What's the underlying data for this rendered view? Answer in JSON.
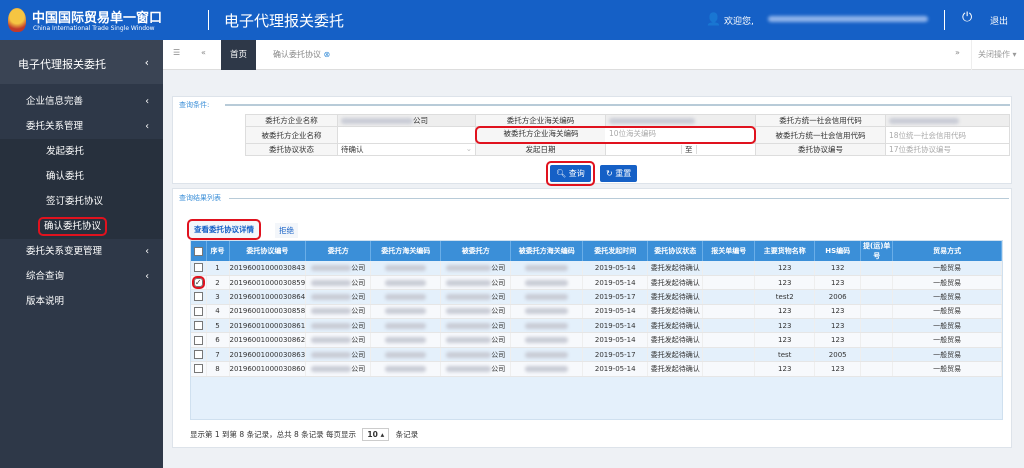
{
  "header": {
    "logo_cn": "中国国际贸易单一窗口",
    "logo_en": "China International Trade Single Window",
    "app_title": "电子代理报关委托",
    "welcome": "欢迎您,",
    "logout": "退出"
  },
  "tabs": {
    "home": "首页",
    "current": "确认委托协议",
    "close_ops": "关闭操作"
  },
  "sidebar": {
    "title": "电子代理报关委托",
    "items": [
      {
        "label": "企业信息完善",
        "chev": true,
        "sub": false
      },
      {
        "label": "委托关系管理",
        "chev": true,
        "sub": false
      },
      {
        "label": "发起委托",
        "sub": true
      },
      {
        "label": "确认委托",
        "sub": true
      },
      {
        "label": "签订委托协议",
        "sub": true
      },
      {
        "label": "确认委托协议",
        "sub": true,
        "active": true
      },
      {
        "label": "委托关系变更管理",
        "chev": true,
        "sub": false
      },
      {
        "label": "综合查询",
        "chev": true,
        "sub": false
      },
      {
        "label": "版本说明",
        "sub": false
      }
    ]
  },
  "query": {
    "legend": "查询条件:",
    "l1": "委托方企业名称",
    "v1_suffix": "公司",
    "l2": "委托方企业海关编码",
    "l3": "委托方统一社会信用代码",
    "l4": "被委托方企业名称",
    "l5": "被委托方企业海关编码",
    "p5": "10位海关编码",
    "l6": "被委托方统一社会信用代码",
    "p6": "18位统一社会信用代码",
    "l7": "委托协议状态",
    "v7": "待确认",
    "l8": "发起日期",
    "to": "至",
    "l9": "委托协议编号",
    "p9": "17位委托协议编号",
    "search": "查询",
    "reset": "重置"
  },
  "results": {
    "legend": "查询结果列表",
    "view_detail": "查看委托协议详情",
    "reject": "拒绝",
    "columns": [
      "序号",
      "委托协议编号",
      "委托方",
      "委托方海关编码",
      "被委托方",
      "被委托方海关编码",
      "委托发起时间",
      "委托协议状态",
      "报关单编号",
      "主要货物名称",
      "HS编码",
      "提(运)单号",
      "贸易方式"
    ],
    "rows": [
      {
        "no": "1",
        "id": "20196001000030843",
        "date": "2019-05-14",
        "status": "委托发起待确认",
        "goods": "123",
        "hs": "132",
        "trade": "一般贸易",
        "checked": false
      },
      {
        "no": "2",
        "id": "20196001000030859",
        "date": "2019-05-14",
        "status": "委托发起待确认",
        "goods": "123",
        "hs": "123",
        "trade": "一般贸易",
        "checked": true
      },
      {
        "no": "3",
        "id": "20196001000030864",
        "date": "2019-05-17",
        "status": "委托发起待确认",
        "goods": "test2",
        "hs": "2006",
        "trade": "一般贸易",
        "checked": false
      },
      {
        "no": "4",
        "id": "20196001000030858",
        "date": "2019-05-14",
        "status": "委托发起待确认",
        "goods": "123",
        "hs": "123",
        "trade": "一般贸易",
        "checked": false
      },
      {
        "no": "5",
        "id": "20196001000030861",
        "date": "2019-05-14",
        "status": "委托发起待确认",
        "goods": "123",
        "hs": "123",
        "trade": "一般贸易",
        "checked": false
      },
      {
        "no": "6",
        "id": "20196001000030862",
        "date": "2019-05-14",
        "status": "委托发起待确认",
        "goods": "123",
        "hs": "123",
        "trade": "一般贸易",
        "checked": false
      },
      {
        "no": "7",
        "id": "20196001000030863",
        "date": "2019-05-17",
        "status": "委托发起待确认",
        "goods": "test",
        "hs": "2005",
        "trade": "一般贸易",
        "checked": false
      },
      {
        "no": "8",
        "id": "20196001000030860",
        "date": "2019-05-14",
        "status": "委托发起待确认",
        "goods": "123",
        "hs": "123",
        "trade": "一般贸易",
        "checked": false
      }
    ],
    "company_suffix": "公司",
    "footer": "显示第 1 到第 8 条记录，总共 8 条记录 每页显示",
    "page_size": "10",
    "footer_end": "条记录"
  }
}
